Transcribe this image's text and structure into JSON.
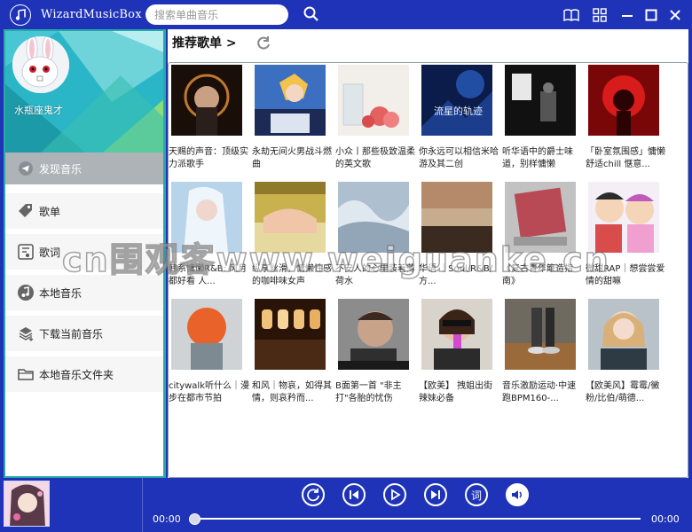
{
  "app": {
    "title": "WizardMusicBox"
  },
  "search": {
    "placeholder": "搜索单曲音乐"
  },
  "sidebar": {
    "user_name": "水瓶座鬼才",
    "items": [
      {
        "label": "发现音乐",
        "icon": "telegram-icon",
        "active": true
      },
      {
        "label": "歌单",
        "icon": "tag-icon",
        "active": false
      },
      {
        "label": "歌词",
        "icon": "lyrics-icon",
        "active": false
      },
      {
        "label": "本地音乐",
        "icon": "music-note-icon",
        "active": false
      },
      {
        "label": "下载当前音乐",
        "icon": "download-icon",
        "active": false
      },
      {
        "label": "本地音乐文件夹",
        "icon": "folder-icon",
        "active": false
      }
    ]
  },
  "main": {
    "section_title": "推荐歌单 >",
    "playlists": [
      {
        "title": "天赐的声音：顶级实力派歌手"
      },
      {
        "title": "永劫无间火男战斗燃曲"
      },
      {
        "title": "小众丨那些极致温柔的英文歌"
      },
      {
        "title": "你永远可以相信米哈游及其二创"
      },
      {
        "title": "听华语中的爵士味道，别样慵懒"
      },
      {
        "title": "「卧室氛围感」慵懒舒适chill 惬意..."
      },
      {
        "title": "韩系慵懒R&B: 风月都好看 人..."
      },
      {
        "title": "纵享丝滑，慵懒性感的咖啡味女声"
      },
      {
        "title": "不安人的心里装着薄荷水"
      },
      {
        "title": "华语 ｜Soul/R&B/方..."
      },
      {
        "title": "《复古青年簸造指南》"
      },
      {
        "title": "微甜RAP｜想尝尝爱情的甜嘛"
      },
      {
        "title": "citywalk听什么｜漫步在都市节拍"
      },
      {
        "title": "和风｜物哀，如得其情，则哀矜而..."
      },
      {
        "title": "B面第一首 \"非主打\"各胎的忧伤"
      },
      {
        "title": "【欧美】 拽姐出街 辣妹必备"
      },
      {
        "title": "音乐激励运动·中速跑BPM160-..."
      },
      {
        "title": "【欧美风】霉霉/黴粉/比伯/萌德..."
      }
    ]
  },
  "player": {
    "current_time": "00:00",
    "total_time": "00:00",
    "progress": 0,
    "lyrics_label": "词"
  },
  "watermark": "cn围观客www.weiguanke.cn",
  "colors": {
    "titlebar": "#1f33b8",
    "accent_teal": "#2aa8a8",
    "active_menu": "#aeb3b8"
  }
}
